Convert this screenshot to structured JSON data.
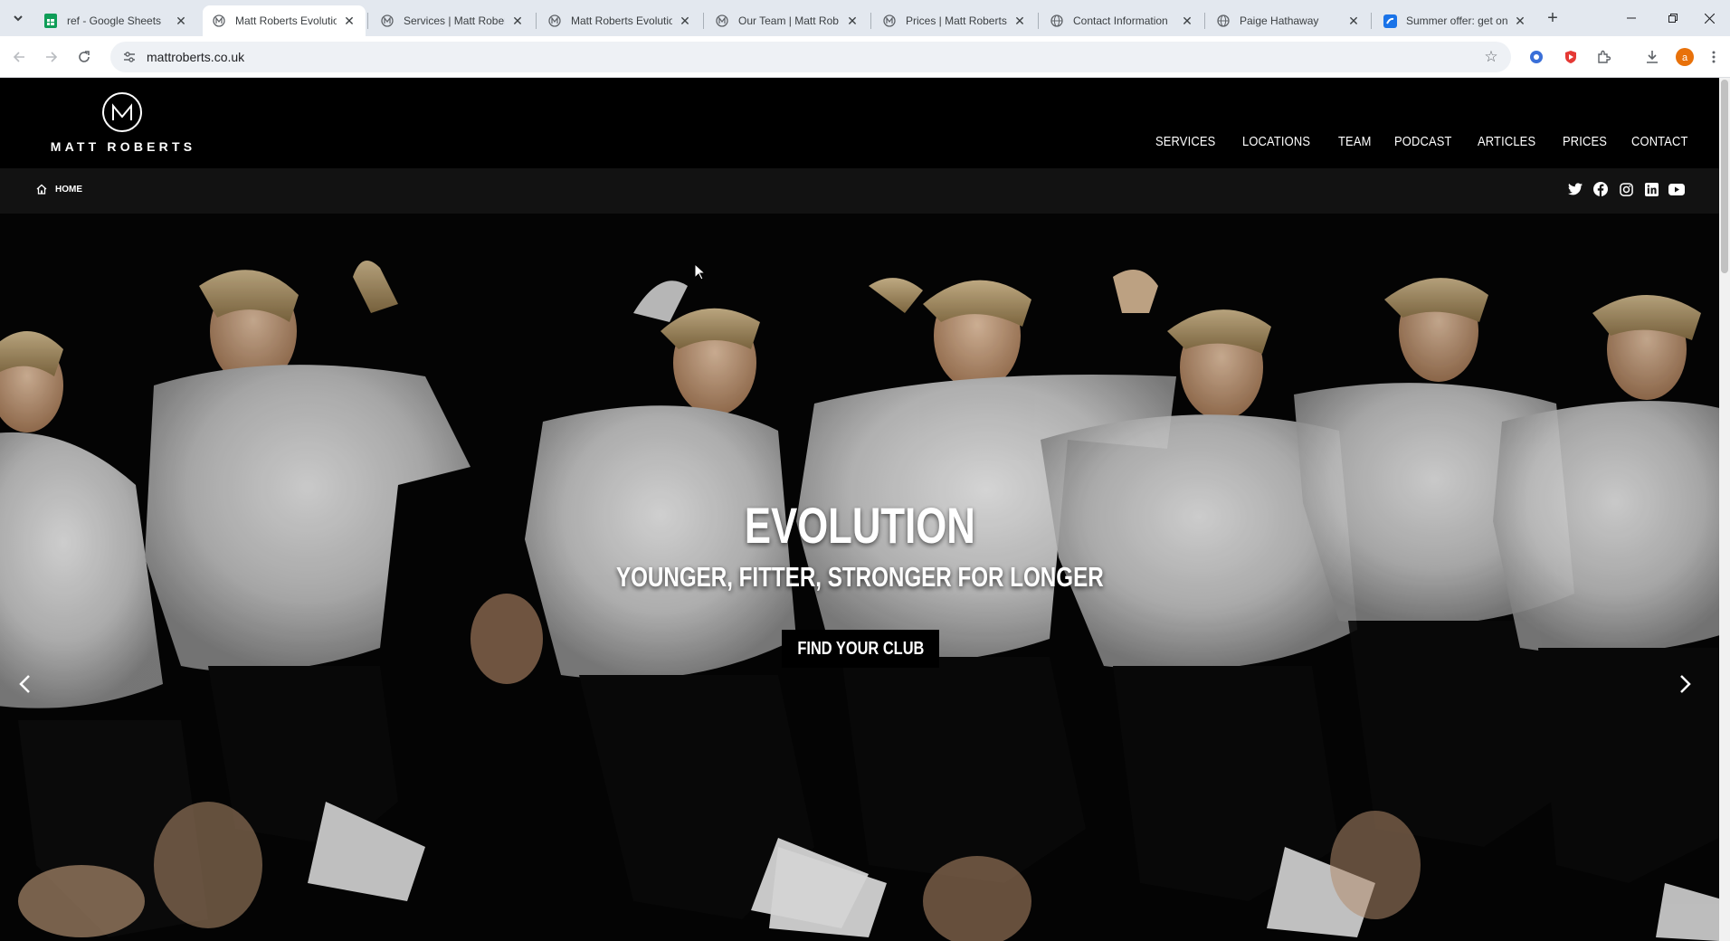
{
  "browser": {
    "tabs": [
      {
        "title": "ref - Google Sheets",
        "favicon": "google-sheets-icon",
        "active": false
      },
      {
        "title": "Matt Roberts Evolutio",
        "favicon": "matt-roberts-icon",
        "active": true
      },
      {
        "title": "Services | Matt Rober",
        "favicon": "matt-roberts-icon",
        "active": false
      },
      {
        "title": "Matt Roberts Evolutio",
        "favicon": "matt-roberts-icon",
        "active": false
      },
      {
        "title": "Our Team | Matt Rob",
        "favicon": "matt-roberts-icon",
        "active": false
      },
      {
        "title": "Prices | Matt Roberts",
        "favicon": "matt-roberts-icon",
        "active": false
      },
      {
        "title": "Contact Information",
        "favicon": "globe-icon",
        "active": false
      },
      {
        "title": "Paige Hathaway",
        "favicon": "globe-icon",
        "active": false
      },
      {
        "title": "Summer offer: get on",
        "favicon": "blue-app-icon",
        "active": false
      }
    ],
    "url": "mattroberts.co.uk",
    "profile_initial": "a",
    "colors": {
      "tabbar": "#e3e8ef",
      "toolbar": "#ffffff",
      "omnibox": "#eef1f5",
      "profile": "#e8710a"
    }
  },
  "site": {
    "logo_text": "MATT ROBERTS",
    "nav": [
      "SERVICES",
      "LOCATIONS",
      "TEAM",
      "PODCAST",
      "ARTICLES",
      "PRICES",
      "CONTACT"
    ],
    "breadcrumb": "HOME",
    "social": [
      "twitter-icon",
      "facebook-icon",
      "instagram-icon",
      "linkedin-icon",
      "youtube-icon"
    ],
    "hero": {
      "title": "EVOLUTION",
      "subtitle": "YOUNGER, FITTER, STRONGER FOR LONGER",
      "button": "FIND YOUR CLUB"
    }
  }
}
